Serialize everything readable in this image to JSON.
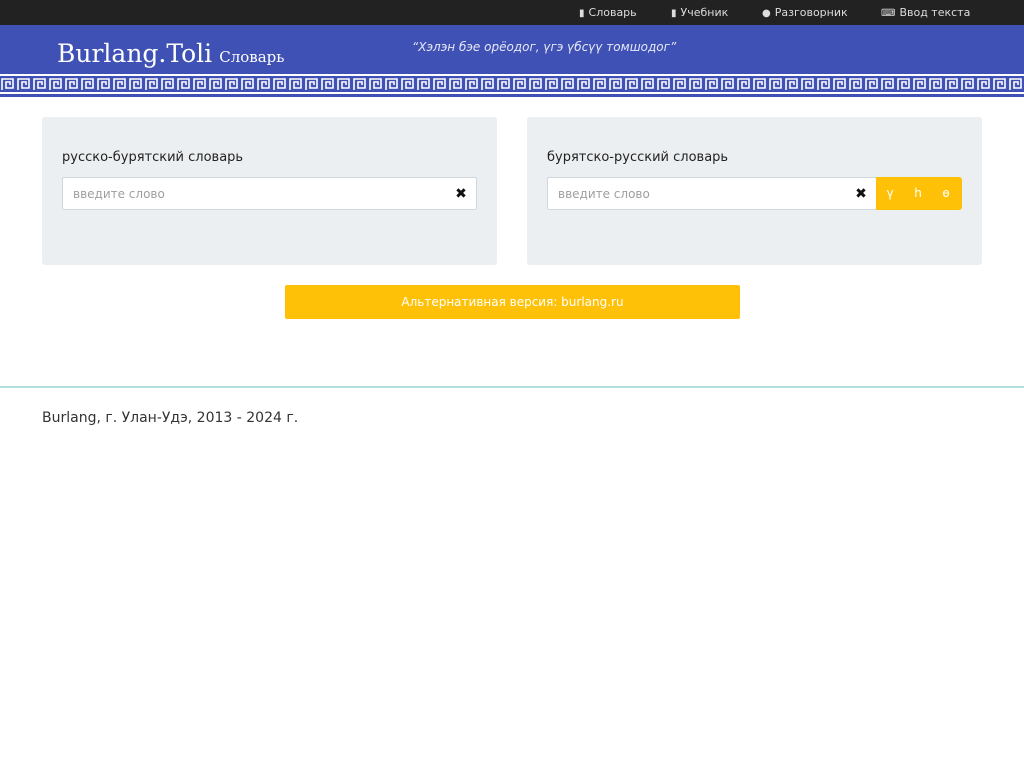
{
  "topnav": {
    "items": [
      {
        "icon": "book-icon",
        "label": "Словарь"
      },
      {
        "icon": "book-icon",
        "label": "Учебник"
      },
      {
        "icon": "chat-icon",
        "label": "Разговорник"
      },
      {
        "icon": "keyboard-icon",
        "label": "Ввод текста"
      }
    ]
  },
  "header": {
    "brand_name": "Burlang.Toli",
    "brand_sub": "Словарь",
    "motto": "“Хэлэн бэе орёодог, үгэ үбсүү томшодог”"
  },
  "ru_bur": {
    "title": "русско-бурятский словарь",
    "placeholder": "введите слово",
    "value": "",
    "clear_glyph": "✖"
  },
  "bur_ru": {
    "title": "бурятско-русский словарь",
    "placeholder": "введите слово",
    "value": "",
    "clear_glyph": "✖",
    "letters": [
      "ү",
      "һ",
      "ө"
    ]
  },
  "alt_button": {
    "label": "Альтернативная версия: burlang.ru"
  },
  "footer": {
    "text": "Burlang, г. Улан-Удэ, 2013 - 2024 г."
  },
  "colors": {
    "topbar": "#222222",
    "header": "#3f51b5",
    "accent": "#ffc107",
    "panel": "#eceff1",
    "footer_line": "#b2dfdb"
  }
}
